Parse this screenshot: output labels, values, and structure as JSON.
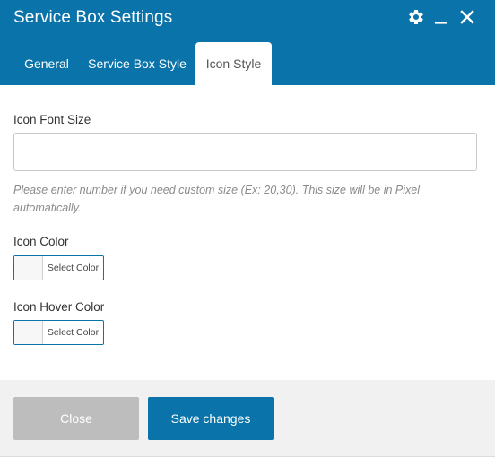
{
  "dialog": {
    "title": "Service Box Settings",
    "icons": [
      "gear-icon",
      "minimize-icon",
      "close-icon"
    ]
  },
  "tabs": [
    {
      "label": "General",
      "active": false
    },
    {
      "label": "Service Box Style",
      "active": false
    },
    {
      "label": "Icon Style",
      "active": true
    }
  ],
  "fields": {
    "icon_font_size": {
      "label": "Icon Font Size",
      "value": "",
      "help": "Please enter number if you need custom size (Ex: 20,30). This size will be in Pixel automatically."
    },
    "icon_color": {
      "label": "Icon Color",
      "button_label": "Select Color"
    },
    "icon_hover_color": {
      "label": "Icon Hover Color",
      "button_label": "Select Color"
    }
  },
  "footer": {
    "close_label": "Close",
    "save_label": "Save changes"
  },
  "colors": {
    "accent": "#0a73aa",
    "disabled": "#bdbdbd",
    "footer_bg": "#f1f1f1"
  }
}
